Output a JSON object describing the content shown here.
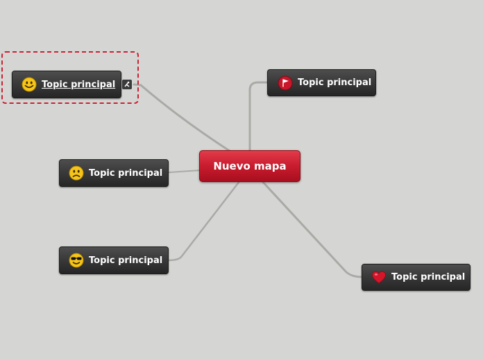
{
  "central": {
    "label": "Nuevo mapa",
    "color": "#c81c2e"
  },
  "topics": [
    {
      "id": "t1",
      "label": "Topic principal",
      "icon": "smiley-happy-icon",
      "selected": true
    },
    {
      "id": "t2",
      "label": "Topic principal",
      "icon": "red-flag-icon",
      "selected": false
    },
    {
      "id": "t3",
      "label": "Topic principal",
      "icon": "smiley-sad-icon",
      "selected": false
    },
    {
      "id": "t4",
      "label": "Topic principal",
      "icon": "smiley-sunglasses-icon",
      "selected": false
    },
    {
      "id": "t5",
      "label": "Topic principal",
      "icon": "red-heart-icon",
      "selected": false
    }
  ],
  "colors": {
    "canvas": "#d5d6d3",
    "node": "#333333",
    "link": "#a9aaa6",
    "selection": "#cc1f33"
  }
}
